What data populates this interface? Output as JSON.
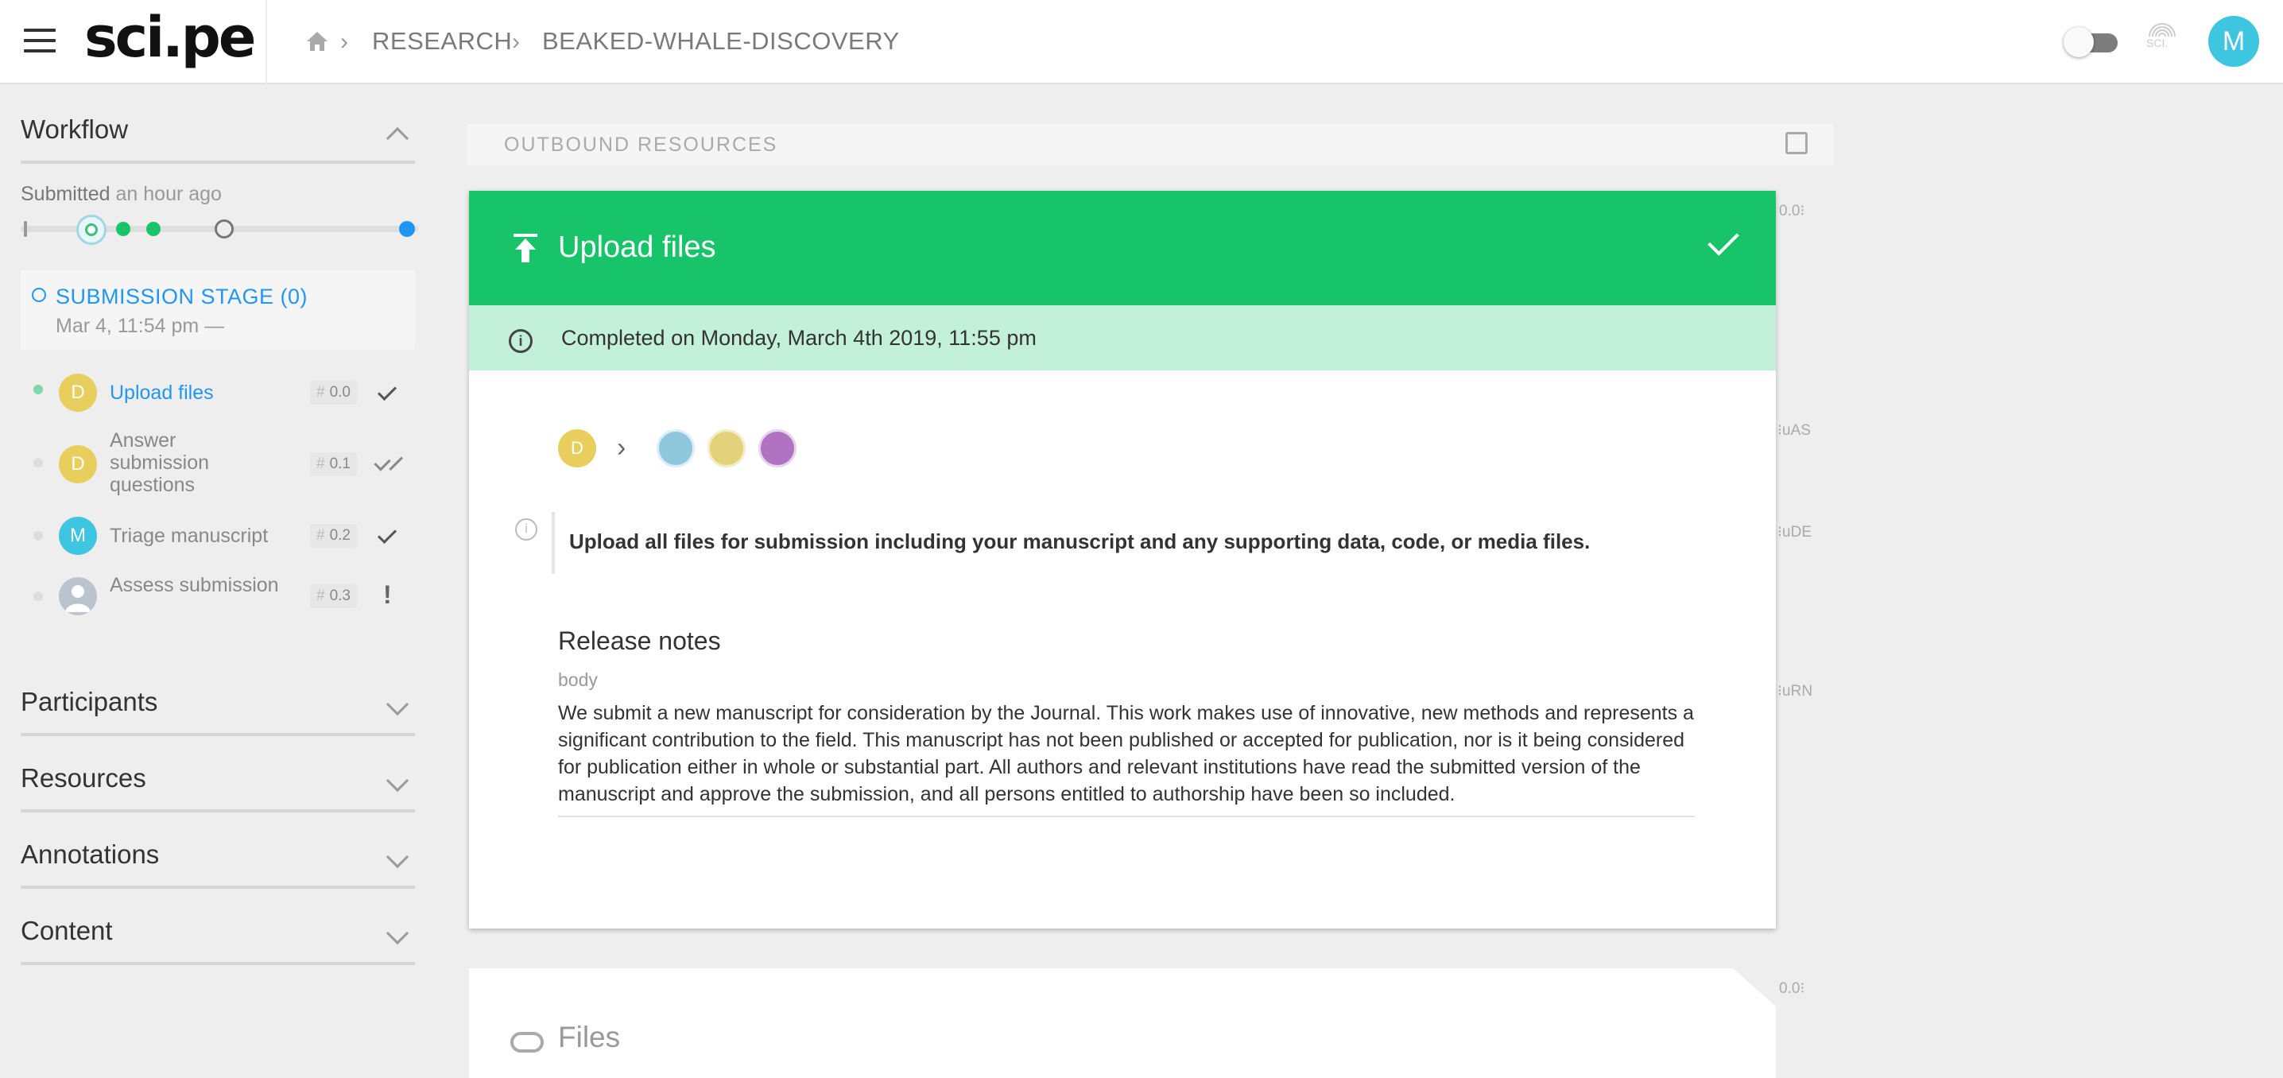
{
  "header": {
    "logo": "sci.pe",
    "breadcrumb": [
      "RESEARCH",
      "BEAKED-WHALE-DISCOVERY"
    ],
    "user_initial": "M",
    "sci_label": "SCI."
  },
  "sidebar": {
    "workflow": {
      "title": "Workflow",
      "submitted_bold": "Submitted",
      "submitted_rest": " an hour ago",
      "stage": {
        "title": "SUBMISSION STAGE (0)",
        "date": "Mar 4, 11:54 pm —"
      },
      "items": [
        {
          "avatar": "D",
          "avatar_color": "#e8ce5d",
          "label": "Upload files",
          "num": "0.0",
          "status": "check",
          "active": true
        },
        {
          "avatar": "D",
          "avatar_color": "#e8ce5d",
          "label": "Answer submission questions",
          "num": "0.1",
          "status": "double-check",
          "active": false
        },
        {
          "avatar": "M",
          "avatar_color": "#3ec5e0",
          "label": "Triage manuscript",
          "num": "0.2",
          "status": "check",
          "active": false
        },
        {
          "avatar": "",
          "avatar_color": "#b9c4ce",
          "label": "Assess submission",
          "num": "0.3",
          "status": "alert",
          "active": false
        }
      ]
    },
    "sections": [
      "Participants",
      "Resources",
      "Annotations",
      "Content"
    ]
  },
  "main": {
    "outbound_title": "OUTBOUND RESOURCES",
    "card": {
      "title": "Upload files",
      "completed": "Completed on Monday, March 4th 2019, 11:55 pm",
      "flow_avatar": "D",
      "description": "Upload all files for submission including your manuscript and any supporting data, code, or media files.",
      "release_notes_title": "Release notes",
      "release_notes_sub": "body",
      "release_notes_body": "We submit a new manuscript for consideration by the Journal. This work makes use of innovative, new methods and represents a significant contribution to the field. This manuscript has not been published or accepted for publication, nor is it being considered for publication either in whole or substantial part. All authors and relevant institutions have read the submitted version of the manuscript and approve the submission, and all persons entitled to authorship have been so included."
    },
    "files_title": "Files",
    "side_labels": [
      "0.0⁝",
      "⁝uAS",
      "⁝uDE",
      "⁝uRN",
      "0.0⁝"
    ]
  },
  "colors": {
    "accent_green": "#17c46a",
    "light_green": "#c3f0d9",
    "link_blue": "#2196f3",
    "avatar_cyan": "#3ec5e0",
    "avatar_yellow": "#e8ce5d"
  }
}
